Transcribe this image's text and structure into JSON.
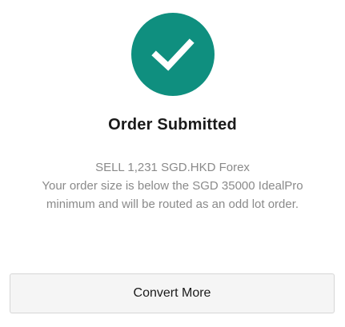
{
  "colors": {
    "accent": "#0f8f7f"
  },
  "status": {
    "icon": "checkmark-icon",
    "title": "Order Submitted"
  },
  "message": {
    "order_line": "SELL 1,231 SGD.HKD Forex",
    "note_line1": "Your order size is below the SGD 35000 IdealPro",
    "note_line2": "minimum and will be routed as an odd lot order."
  },
  "actions": {
    "convert_more_label": "Convert More"
  }
}
